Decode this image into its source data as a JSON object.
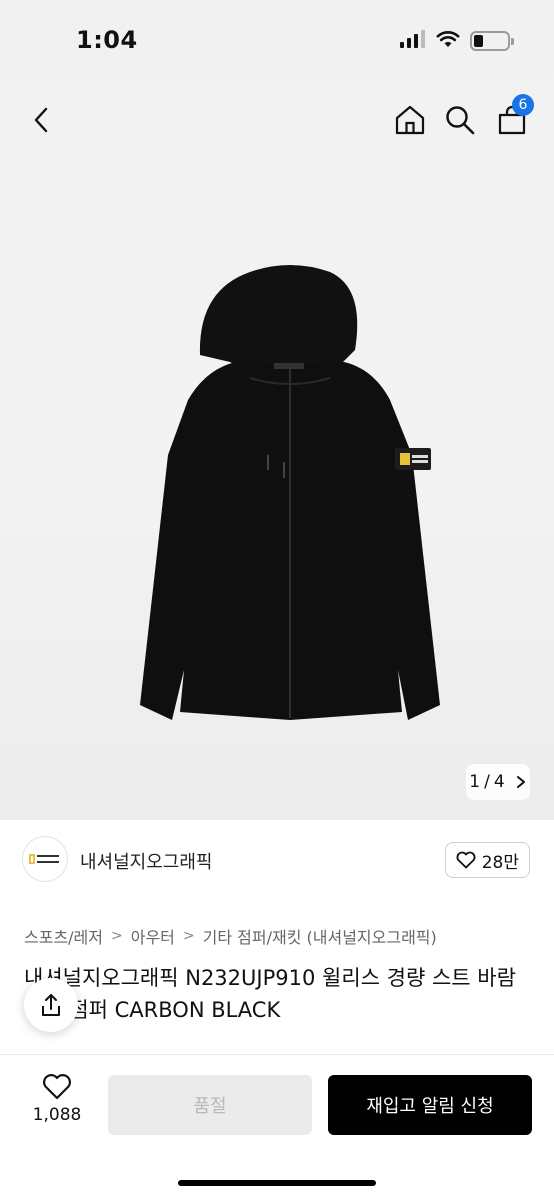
{
  "status": {
    "time": "1:04"
  },
  "nav": {
    "cart_count": "6"
  },
  "gallery": {
    "current": "1",
    "separator": "/",
    "total": "4"
  },
  "brand": {
    "name": "내셔널지오그래픽",
    "likes": "28만"
  },
  "breadcrumb": [
    "스포츠/레저",
    "아우터",
    "기타 점퍼/재킷 (내셔널지오그래픽)"
  ],
  "product": {
    "title": "내셔널지오그래픽 N232UJP910 윌리스 경량 스트 바람막이 점퍼 CARBON BLACK"
  },
  "footer": {
    "like_count": "1,088",
    "soldout_label": "품절",
    "restock_label": "재입고 알림 신청"
  },
  "colors": {
    "badge": "#1a73e8",
    "primary_button": "#000000",
    "disabled_button": "#ebebeb"
  }
}
